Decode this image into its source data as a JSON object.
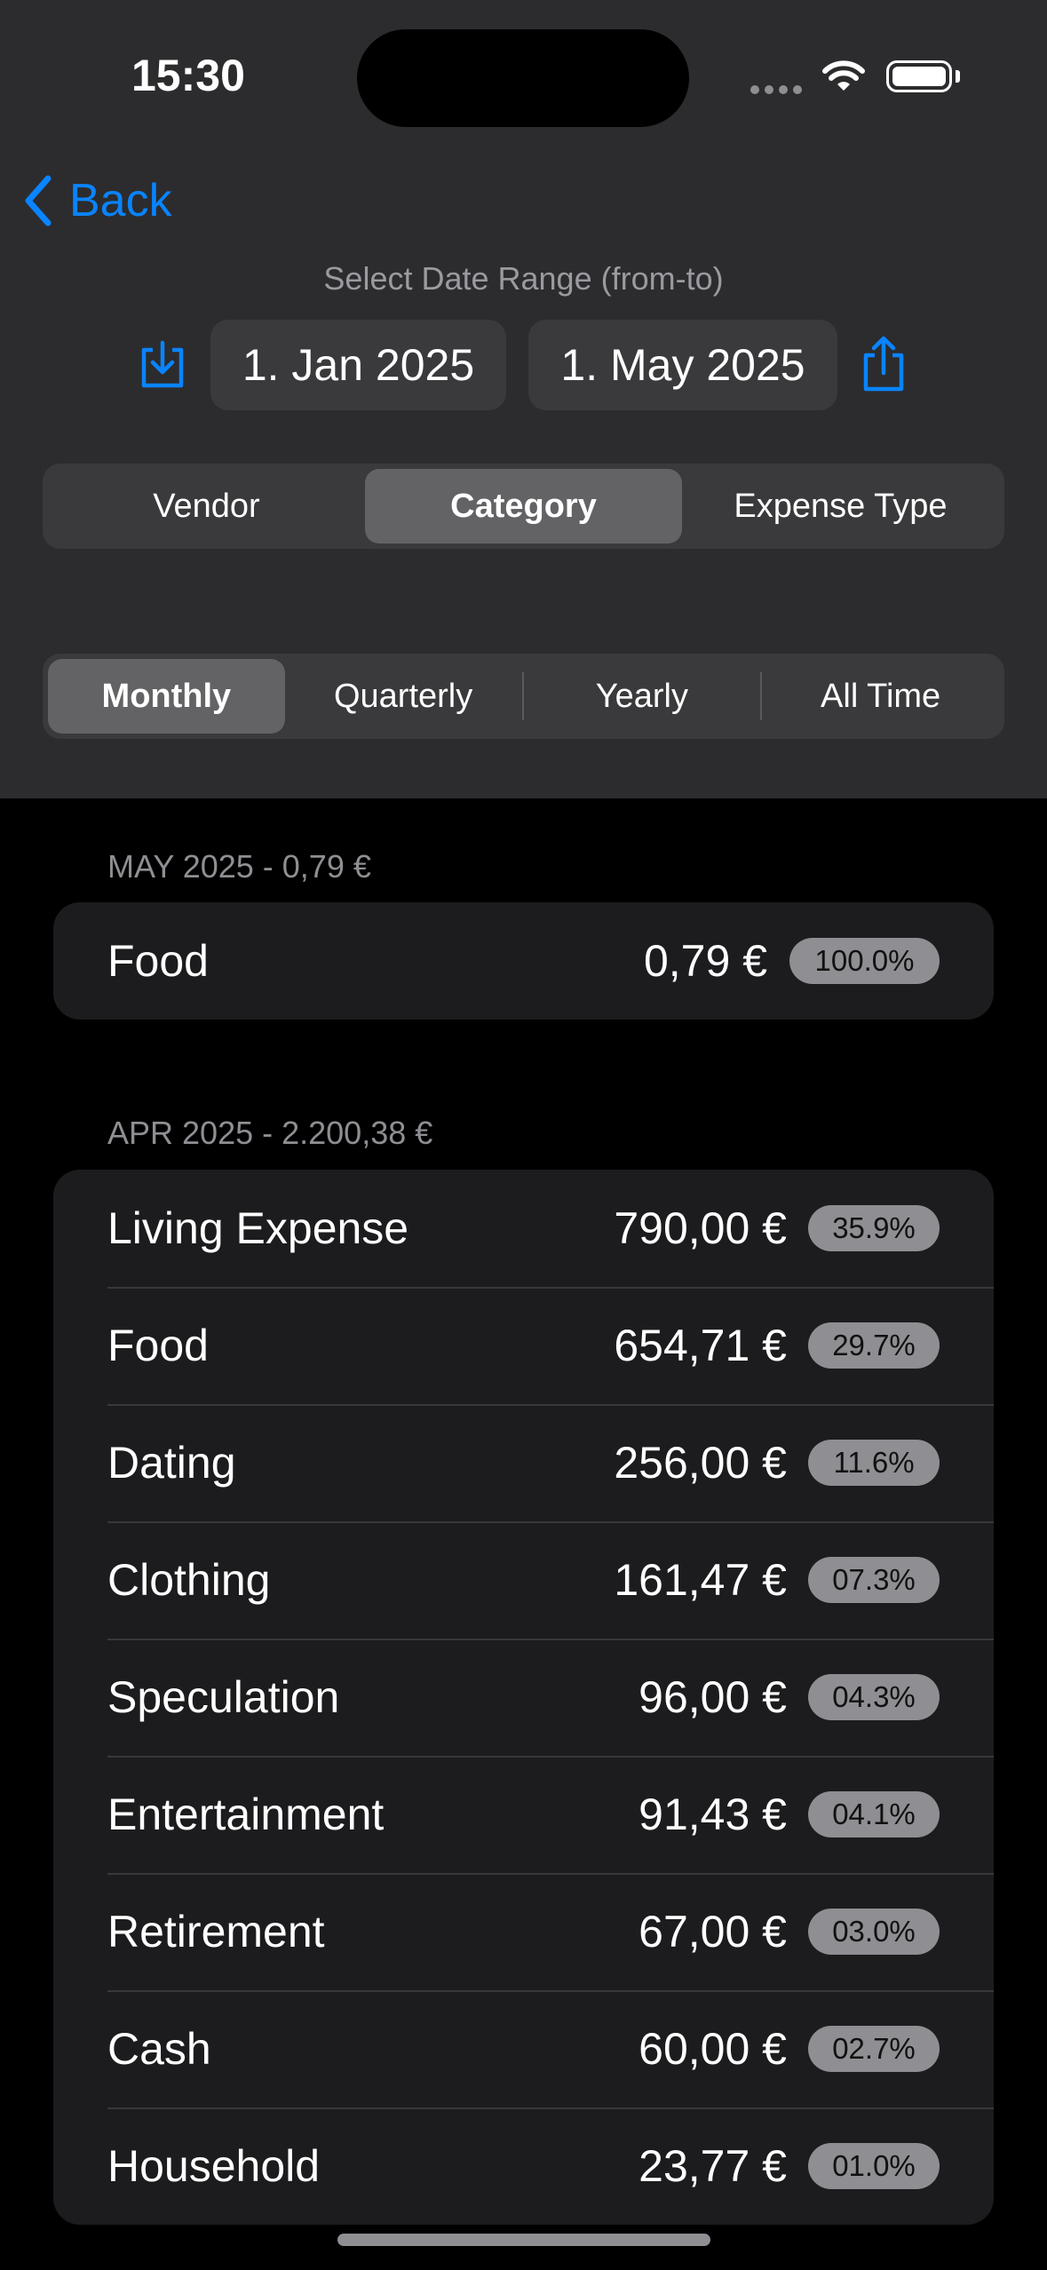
{
  "status_bar": {
    "time": "15:30"
  },
  "nav": {
    "back_label": "Back"
  },
  "date_range": {
    "label": "Select Date Range (from-to)",
    "from": "1. Jan 2025",
    "to": "1. May 2025"
  },
  "group_by": {
    "options": [
      "Vendor",
      "Category",
      "Expense Type"
    ],
    "selected": "Category"
  },
  "period": {
    "options": [
      "Monthly",
      "Quarterly",
      "Yearly",
      "All Time"
    ],
    "selected": "Monthly"
  },
  "sections": [
    {
      "header": "MAY 2025 - 0,79 €",
      "rows": [
        {
          "label": "Food",
          "amount": "0,79 €",
          "percent": "100.0%"
        }
      ]
    },
    {
      "header": "APR 2025 - 2.200,38 €",
      "rows": [
        {
          "label": "Living Expense",
          "amount": "790,00 €",
          "percent": "35.9%"
        },
        {
          "label": "Food",
          "amount": "654,71 €",
          "percent": "29.7%"
        },
        {
          "label": "Dating",
          "amount": "256,00 €",
          "percent": "11.6%"
        },
        {
          "label": "Clothing",
          "amount": "161,47 €",
          "percent": "07.3%"
        },
        {
          "label": "Speculation",
          "amount": "96,00 €",
          "percent": "04.3%"
        },
        {
          "label": "Entertainment",
          "amount": "91,43 €",
          "percent": "04.1%"
        },
        {
          "label": "Retirement",
          "amount": "67,00 €",
          "percent": "03.0%"
        },
        {
          "label": "Cash",
          "amount": "60,00 €",
          "percent": "02.7%"
        },
        {
          "label": "Household",
          "amount": "23,77 €",
          "percent": "01.0%"
        }
      ]
    }
  ],
  "colors": {
    "accent": "#0a84ff",
    "header_bg": "#2c2c2e",
    "card_bg": "#1c1c1e",
    "badge_bg": "#8e8e93"
  },
  "icons": {
    "back": "chevron-left-icon",
    "import": "tray-arrow-down-icon",
    "export": "square-arrow-up-icon",
    "wifi": "wifi-icon",
    "battery": "battery-icon"
  }
}
